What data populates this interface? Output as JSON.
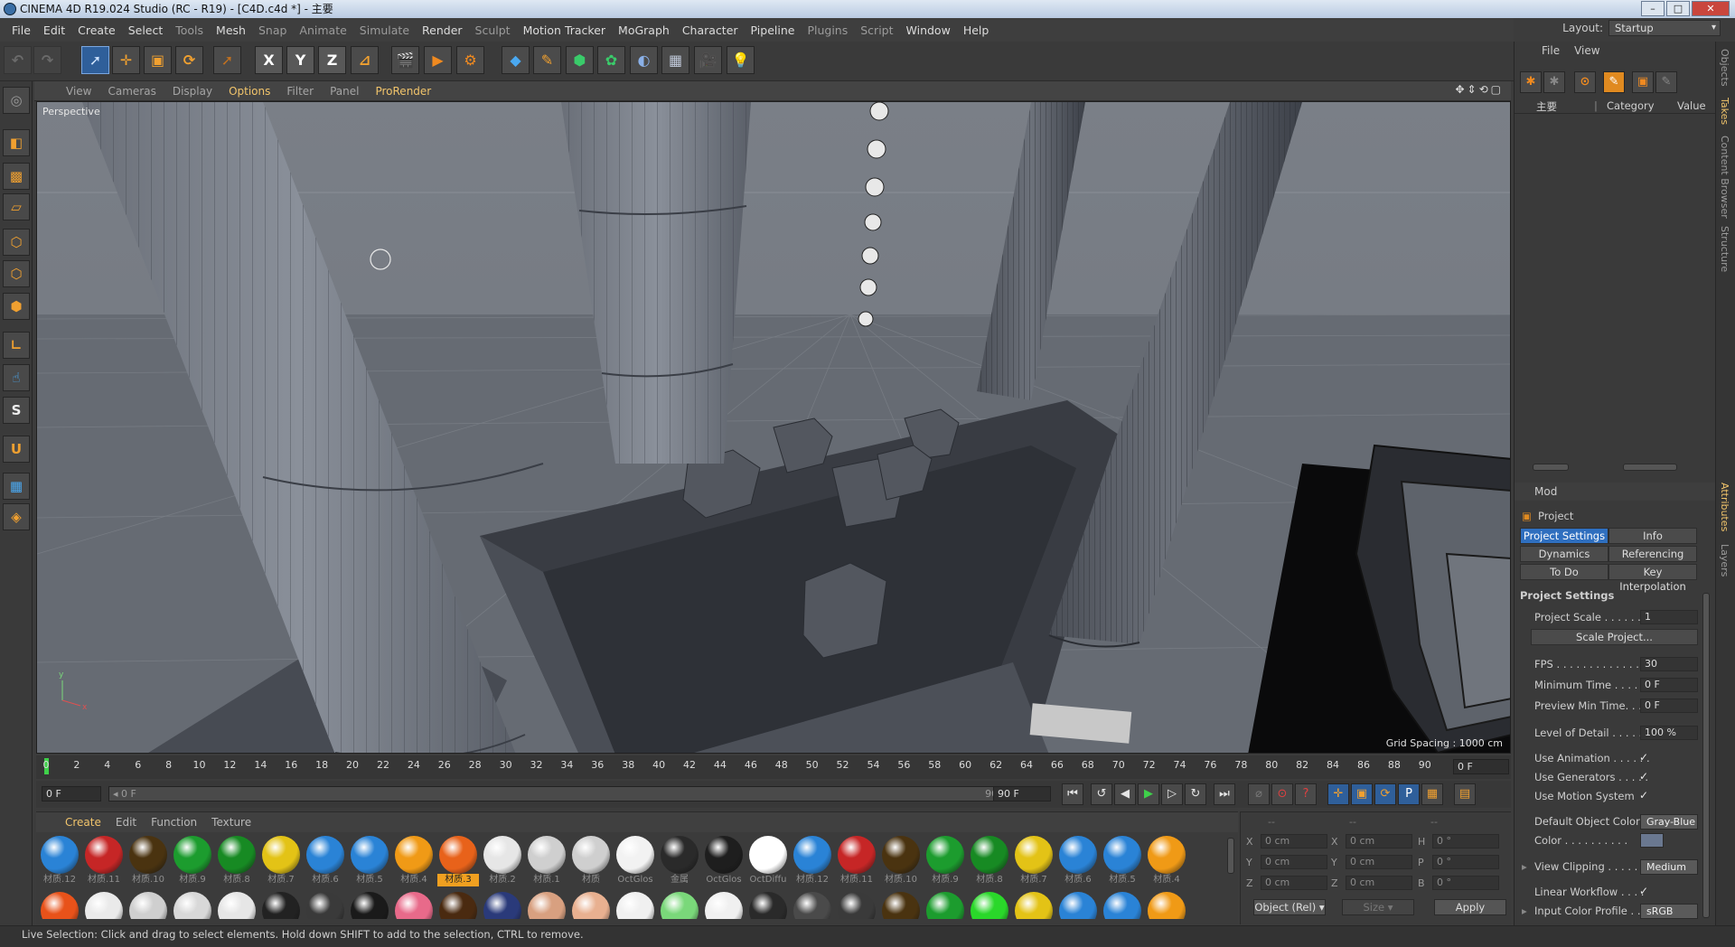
{
  "window": {
    "title": "CINEMA 4D R19.024 Studio (RC - R19) - [C4D.c4d *] - 主要",
    "min": "–",
    "max": "□",
    "close": "✕"
  },
  "menubar": {
    "items": [
      "File",
      "Edit",
      "Create",
      "Select",
      "Tools",
      "Mesh",
      "Snap",
      "Animate",
      "Simulate",
      "Render",
      "Sculpt",
      "Motion Tracker",
      "MoGraph",
      "Character",
      "Pipeline",
      "Plugins",
      "Script",
      "Window",
      "Help"
    ],
    "layout_label": "Layout:",
    "layout_value": "Startup"
  },
  "viewport": {
    "menu": [
      "View",
      "Cameras",
      "Display",
      "Options",
      "Filter",
      "Panel",
      "ProRender"
    ],
    "label": "Perspective",
    "grid_spacing": "Grid Spacing : 1000 cm",
    "nav_icons": "✥⇕⟲▢"
  },
  "timeline": {
    "ticks": [
      "0",
      "2",
      "4",
      "6",
      "8",
      "10",
      "12",
      "14",
      "16",
      "18",
      "20",
      "22",
      "24",
      "26",
      "28",
      "30",
      "32",
      "34",
      "36",
      "38",
      "40",
      "42",
      "44",
      "46",
      "48",
      "50",
      "52",
      "54",
      "56",
      "58",
      "60",
      "62",
      "64",
      "66",
      "68",
      "70",
      "72",
      "74",
      "76",
      "78",
      "80",
      "82",
      "84",
      "86",
      "88",
      "90"
    ],
    "current_frame": "0 F",
    "start_field": "0 F",
    "range_start": "◂ 0 F",
    "range_end": "90 F ▸",
    "end_field": "90 F"
  },
  "materials": {
    "menu": [
      "Create",
      "Edit",
      "Function",
      "Texture"
    ],
    "row1": [
      {
        "name": "材质.12",
        "color": "#2a83d6"
      },
      {
        "name": "材质.11",
        "color": "#c62626"
      },
      {
        "name": "材质.10",
        "color": "#4a3310"
      },
      {
        "name": "材质.9",
        "color": "#1c9c2e"
      },
      {
        "name": "材质.8",
        "color": "#178a23"
      },
      {
        "name": "材质.7",
        "color": "#e3c316"
      },
      {
        "name": "材质.6",
        "color": "#2a83d6"
      },
      {
        "name": "材质.5",
        "color": "#2a83d6"
      },
      {
        "name": "材质.4",
        "color": "#f09a16"
      },
      {
        "name": "材质.3",
        "color": "#e8621a"
      },
      {
        "name": "材质.2",
        "color": "#e6e6e6"
      },
      {
        "name": "材质.1",
        "color": "#cfcfcf"
      },
      {
        "name": "材质",
        "color": "#cfcfcf"
      },
      {
        "name": "OctGlos",
        "color": "#f2f2f2"
      },
      {
        "name": "金属",
        "color": "#2a2a2a"
      },
      {
        "name": "OctGlos",
        "color": "#1e1e1e"
      },
      {
        "name": "OctDiffu",
        "color": "#ffffff"
      },
      {
        "name": "材质.12",
        "color": "#2a83d6"
      },
      {
        "name": "材质.11",
        "color": "#c62626"
      },
      {
        "name": "材质.10",
        "color": "#4a3310"
      },
      {
        "name": "材质.9",
        "color": "#1c9c2e"
      },
      {
        "name": "材质.8",
        "color": "#178a23"
      },
      {
        "name": "材质.7",
        "color": "#e3c316"
      },
      {
        "name": "材质.6",
        "color": "#2a83d6"
      },
      {
        "name": "材质.5",
        "color": "#2a83d6"
      },
      {
        "name": "材质.4",
        "color": "#f09a16"
      }
    ],
    "row2_colors": [
      "#e8521a",
      "#eaeaea",
      "#cfcfcf",
      "#d8d8d8",
      "#e6e6e6",
      "#222222",
      "#3a3a3a",
      "#1a1a1a",
      "#e86a8a",
      "#4a2a10",
      "#2a3a7a",
      "#d8a080",
      "#e8b090",
      "#f0f0f0",
      "#7ad87a",
      "#f0f0f0",
      "#2a2a2a",
      "#4a4a4a",
      "#3a3a3a",
      "#4a3310",
      "#1c9c2e",
      "#2ad82a",
      "#e3c316",
      "#2a83d6",
      "#2a83d6",
      "#f09a16"
    ]
  },
  "coords": {
    "header": [
      "--",
      "--",
      "--"
    ],
    "rows": [
      {
        "a": "X",
        "av": "0 cm",
        "b": "X",
        "bv": "0 cm",
        "c": "H",
        "cv": "0 °"
      },
      {
        "a": "Y",
        "av": "0 cm",
        "b": "Y",
        "bv": "0 cm",
        "c": "P",
        "cv": "0 °"
      },
      {
        "a": "Z",
        "av": "0 cm",
        "b": "Z",
        "bv": "0 cm",
        "c": "B",
        "cv": "0 °"
      }
    ],
    "object_mode": "Object (Rel) ▾",
    "size_mode": "Size ▾",
    "apply": "Apply"
  },
  "objects": {
    "menu": [
      "File",
      "View"
    ],
    "col_name": "主要",
    "col_category": "Category",
    "col_value": "Value"
  },
  "attributes": {
    "menu": "Mod",
    "title": "Project",
    "tabs": [
      "Project Settings",
      "Info",
      "Dynamics",
      "Referencing",
      "To Do",
      "Key Interpolation"
    ],
    "section": "Project Settings",
    "scale_label": "Project Scale . . . . . .",
    "scale_value": "1",
    "scale_button": "Scale Project...",
    "fps_label": "FPS . . . . . . . . . . . . . . .",
    "fps_value": "30",
    "min_time_label": "Minimum Time . . . . .",
    "min_time_value": "0 F",
    "preview_min_label": "Preview Min Time. . .",
    "preview_min_value": "0 F",
    "lod_label": "Level of Detail . . . . .",
    "lod_value": "100 %",
    "use_anim_label": "Use Animation . . . . . .",
    "use_gen_label": "Use Generators . . . . .",
    "use_motion_label": "Use Motion System",
    "check": "✓",
    "default_color_label": "Default Object Color",
    "default_color_value": "Gray-Blue",
    "color_label": "Color . . . . . . . . . .",
    "view_clip_label": "View Clipping . . . . . .",
    "view_clip_value": "Medium",
    "linear_label": "Linear Workflow . . . .",
    "input_profile_label": "Input Color Profile . .",
    "input_profile_value": "sRGB"
  },
  "side_tabs": [
    "Objects",
    "Takes",
    "Content Browser",
    "Structure",
    "Attributes",
    "Layers"
  ],
  "status": "Live Selection: Click and drag to select elements. Hold down SHIFT to add to the selection, CTRL to remove."
}
